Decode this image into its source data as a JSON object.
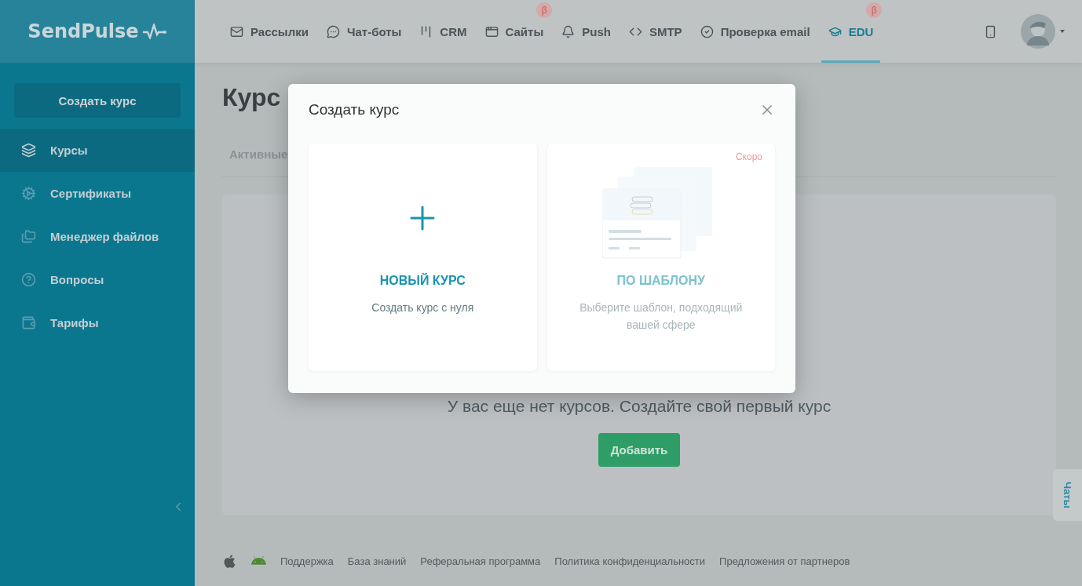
{
  "logo": "SendPulse",
  "create_button": "Создать курс",
  "sidebar": {
    "items": [
      {
        "label": "Курсы",
        "selected": true
      },
      {
        "label": "Сертификаты",
        "selected": false
      },
      {
        "label": "Менеджер файлов",
        "selected": false
      },
      {
        "label": "Вопросы",
        "selected": false
      },
      {
        "label": "Тарифы",
        "selected": false
      }
    ]
  },
  "nav": {
    "items": [
      {
        "label": "Рассылки",
        "selected": false
      },
      {
        "label": "Чат-боты",
        "selected": false
      },
      {
        "label": "CRM",
        "selected": false
      },
      {
        "label": "Сайты",
        "selected": false,
        "beta_mark": "β"
      },
      {
        "label": "Push",
        "selected": false
      },
      {
        "label": "SMTP",
        "selected": false
      },
      {
        "label": "Проверка email",
        "selected": false
      },
      {
        "label": "EDU",
        "selected": true,
        "beta_mark": "β"
      }
    ]
  },
  "page": {
    "title": "Курс",
    "tabs": [
      {
        "label": "Активные",
        "selected": false
      }
    ],
    "empty_text": "У вас еще нет курсов. Создайте свой первый курс",
    "add_button": "Добавить"
  },
  "chats_tab": "Чаты",
  "footer": {
    "links": [
      "Поддержка",
      "База знаний",
      "Реферальная программа",
      "Политика конфиденциальности",
      "Предложения от партнеров"
    ]
  },
  "modal": {
    "title": "Создать курс",
    "options": [
      {
        "kind": "new",
        "title": "НОВЫЙ КУРС",
        "description": "Создать курс с нуля",
        "disabled": false
      },
      {
        "kind": "template",
        "title": "ПО ШАБЛОНУ",
        "description": "Выберите шаблон, подходящий вашей сфере",
        "disabled": true,
        "badge": "Скоро"
      }
    ]
  }
}
